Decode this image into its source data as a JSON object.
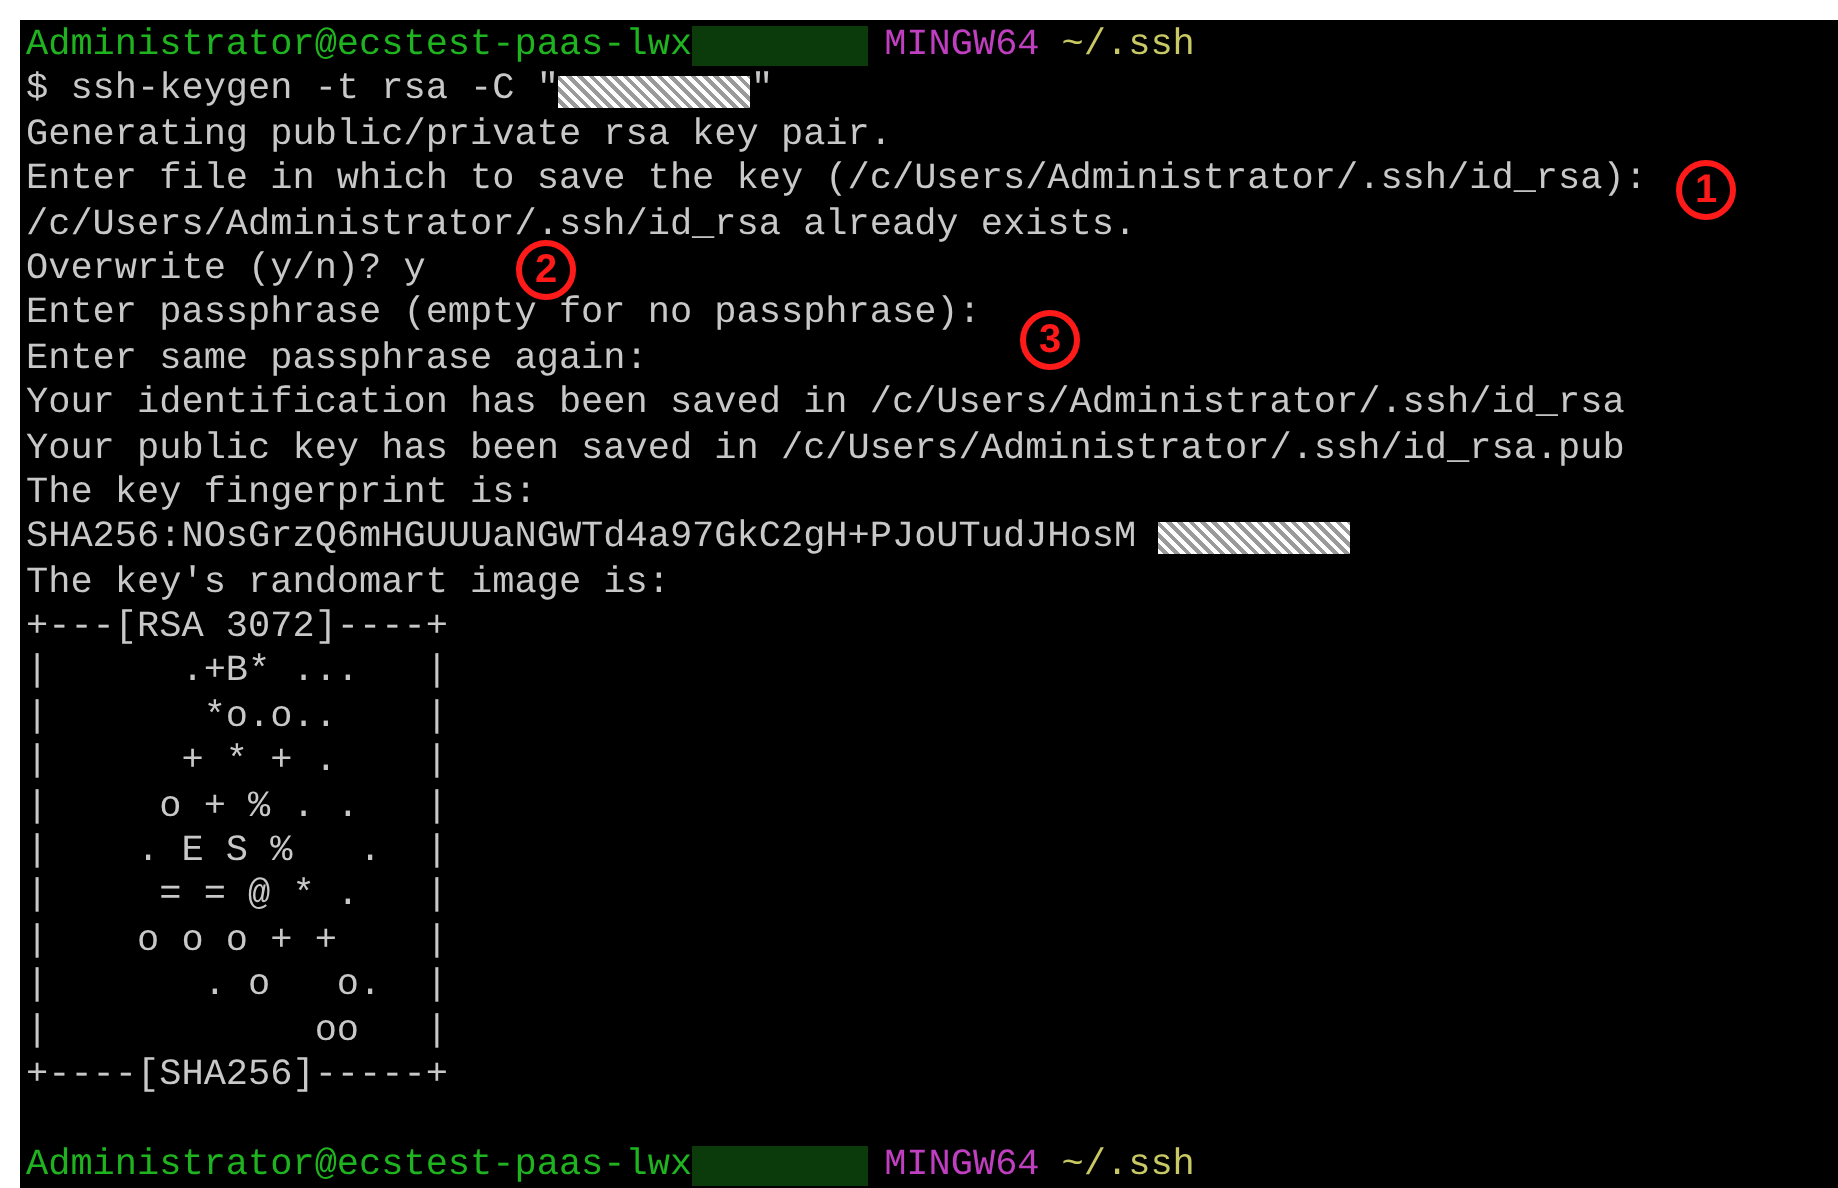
{
  "lines": [
    {
      "kind": "prompt",
      "user": "Administrator@ecstest-paas-lwx",
      "shell": "MINGW64",
      "path": "~/.ssh"
    },
    {
      "kind": "redacted",
      "before": "$ ssh-keygen -t rsa -C \"",
      "after": "\""
    },
    {
      "kind": "text",
      "text": "Generating public/private rsa key pair."
    },
    {
      "kind": "text",
      "text": "Enter file in which to save the key (/c/Users/Administrator/.ssh/id_rsa):"
    },
    {
      "kind": "text",
      "text": "/c/Users/Administrator/.ssh/id_rsa already exists."
    },
    {
      "kind": "text",
      "text": "Overwrite (y/n)? y"
    },
    {
      "kind": "text",
      "text": "Enter passphrase (empty for no passphrase):"
    },
    {
      "kind": "text",
      "text": "Enter same passphrase again:"
    },
    {
      "kind": "text",
      "text": "Your identification has been saved in /c/Users/Administrator/.ssh/id_rsa"
    },
    {
      "kind": "text",
      "text": "Your public key has been saved in /c/Users/Administrator/.ssh/id_rsa.pub"
    },
    {
      "kind": "text",
      "text": "The key fingerprint is:"
    },
    {
      "kind": "redacted",
      "before": "SHA256:NOsGrzQ6mHGUUUaNGWTd4a97GkC2gH+PJoUTudJHosM "
    },
    {
      "kind": "text",
      "text": "The key's randomart image is:"
    },
    {
      "kind": "art",
      "text": "+---[RSA 3072]----+"
    },
    {
      "kind": "art",
      "text": "|      .+B* ...   |"
    },
    {
      "kind": "art",
      "text": "|       *o.o..    |"
    },
    {
      "kind": "art",
      "text": "|      + * + .    |"
    },
    {
      "kind": "art",
      "text": "|     o + % . .   |"
    },
    {
      "kind": "art",
      "text": "|    . E S %   .  |"
    },
    {
      "kind": "art",
      "text": "|     = = @ * .   |"
    },
    {
      "kind": "art",
      "text": "|    o o o + +    |"
    },
    {
      "kind": "art",
      "text": "|       . o   o.  |"
    },
    {
      "kind": "art",
      "text": "|            oo   |"
    },
    {
      "kind": "art",
      "text": "+----[SHA256]-----+"
    },
    {
      "kind": "blank"
    },
    {
      "kind": "prompt",
      "user": "Administrator@ecstest-paas-lwx",
      "shell": "MINGW64",
      "path": "~/.ssh"
    }
  ],
  "annotations": [
    {
      "label": "1"
    },
    {
      "label": "2"
    },
    {
      "label": "3"
    }
  ]
}
